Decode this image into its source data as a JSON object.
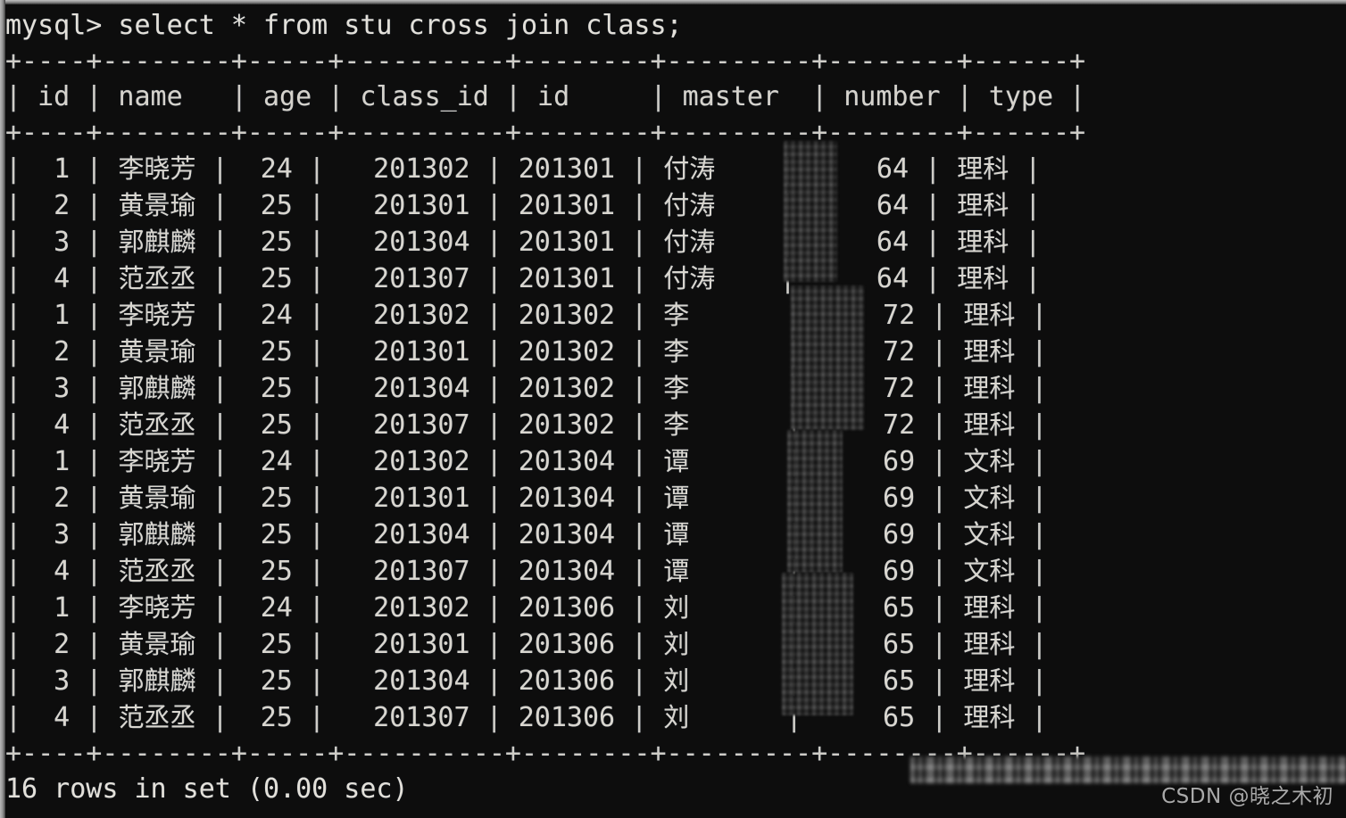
{
  "terminal": {
    "prompt": "mysql>",
    "command": " select * from stu cross join class;",
    "prompt_line": "mysql> select * from stu cross join class;",
    "status_line": "16 rows in set (0.00 sec)",
    "row_count": 16,
    "elapsed": "0.00 sec",
    "background_color": "#0d0d0d",
    "text_color": "#d6d3cc"
  },
  "table": {
    "separator": "+----+--------+-----+----------+--------+---------+--------+------+",
    "columns": [
      {
        "name": "id",
        "width": 4,
        "align": "right",
        "source": "stu"
      },
      {
        "name": "name",
        "width": 8,
        "align": "left",
        "source": "stu"
      },
      {
        "name": "age",
        "width": 5,
        "align": "right",
        "source": "stu"
      },
      {
        "name": "class_id",
        "width": 10,
        "align": "right",
        "source": "stu"
      },
      {
        "name": "id",
        "width": 8,
        "align": "left",
        "source": "class"
      },
      {
        "name": "master",
        "width": 9,
        "align": "left",
        "source": "class"
      },
      {
        "name": "number",
        "width": 8,
        "align": "right",
        "source": "class"
      },
      {
        "name": "type",
        "width": 6,
        "align": "left",
        "source": "class"
      }
    ],
    "headers": [
      "id",
      "name",
      "age",
      "class_id",
      "id",
      "master",
      "number",
      "type"
    ],
    "rows": [
      {
        "id": "1",
        "name": "李晓芳",
        "age": "24",
        "class_id": "201302",
        "class_ref_id": "201301",
        "master": "付涛",
        "number": "64",
        "type": "理科",
        "master_redacted": true
      },
      {
        "id": "2",
        "name": "黄景瑜",
        "age": "25",
        "class_id": "201301",
        "class_ref_id": "201301",
        "master": "付涛",
        "number": "64",
        "type": "理科",
        "master_redacted": true
      },
      {
        "id": "3",
        "name": "郭麒麟",
        "age": "25",
        "class_id": "201304",
        "class_ref_id": "201301",
        "master": "付涛",
        "number": "64",
        "type": "理科",
        "master_redacted": true
      },
      {
        "id": "4",
        "name": "范丞丞",
        "age": "25",
        "class_id": "201307",
        "class_ref_id": "201301",
        "master": "付涛",
        "number": "64",
        "type": "理科",
        "master_redacted": true
      },
      {
        "id": "1",
        "name": "李晓芳",
        "age": "24",
        "class_id": "201302",
        "class_ref_id": "201302",
        "master": "李",
        "number": "72",
        "type": "理科",
        "master_redacted": true
      },
      {
        "id": "2",
        "name": "黄景瑜",
        "age": "25",
        "class_id": "201301",
        "class_ref_id": "201302",
        "master": "李",
        "number": "72",
        "type": "理科",
        "master_redacted": true
      },
      {
        "id": "3",
        "name": "郭麒麟",
        "age": "25",
        "class_id": "201304",
        "class_ref_id": "201302",
        "master": "李",
        "number": "72",
        "type": "理科",
        "master_redacted": true
      },
      {
        "id": "4",
        "name": "范丞丞",
        "age": "25",
        "class_id": "201307",
        "class_ref_id": "201302",
        "master": "李",
        "number": "72",
        "type": "理科",
        "master_redacted": true
      },
      {
        "id": "1",
        "name": "李晓芳",
        "age": "24",
        "class_id": "201302",
        "class_ref_id": "201304",
        "master": "谭",
        "number": "69",
        "type": "文科",
        "master_redacted": true
      },
      {
        "id": "2",
        "name": "黄景瑜",
        "age": "25",
        "class_id": "201301",
        "class_ref_id": "201304",
        "master": "谭",
        "number": "69",
        "type": "文科",
        "master_redacted": true
      },
      {
        "id": "3",
        "name": "郭麒麟",
        "age": "25",
        "class_id": "201304",
        "class_ref_id": "201304",
        "master": "谭",
        "number": "69",
        "type": "文科",
        "master_redacted": true
      },
      {
        "id": "4",
        "name": "范丞丞",
        "age": "25",
        "class_id": "201307",
        "class_ref_id": "201304",
        "master": "谭",
        "number": "69",
        "type": "文科",
        "master_redacted": true
      },
      {
        "id": "1",
        "name": "李晓芳",
        "age": "24",
        "class_id": "201302",
        "class_ref_id": "201306",
        "master": "刘",
        "number": "65",
        "type": "理科",
        "master_redacted": true
      },
      {
        "id": "2",
        "name": "黄景瑜",
        "age": "25",
        "class_id": "201301",
        "class_ref_id": "201306",
        "master": "刘",
        "number": "65",
        "type": "理科",
        "master_redacted": true
      },
      {
        "id": "3",
        "name": "郭麒麟",
        "age": "25",
        "class_id": "201304",
        "class_ref_id": "201306",
        "master": "刘",
        "number": "65",
        "type": "理科",
        "master_redacted": true
      },
      {
        "id": "4",
        "name": "范丞丞",
        "age": "25",
        "class_id": "201307",
        "class_ref_id": "201306",
        "master": "刘",
        "number": "65",
        "type": "理科",
        "master_redacted": true
      }
    ]
  },
  "watermark": {
    "text": "CSDN @晓之木初",
    "url_redacted": true
  }
}
